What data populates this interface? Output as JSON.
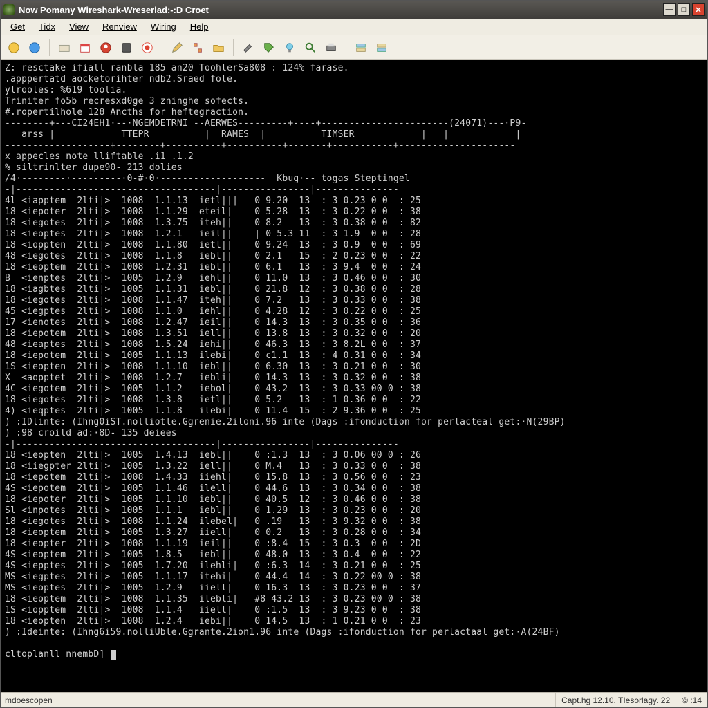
{
  "window": {
    "title": "Now Pomany Wireshark-Wreserlad:-:D Croet"
  },
  "menu": [
    "Get",
    "Tidx",
    "View",
    "Renview",
    "Wiring",
    "Help"
  ],
  "toolbar_icons": [
    "world-yellow-icon",
    "world-blue-icon",
    "folder-open-icon",
    "calendar-icon",
    "user-red-icon",
    "disk-icon",
    "circle-red-icon",
    "pencil-icon",
    "struct-icon",
    "folder-icon",
    "hammer-icon",
    "tag-icon",
    "bulb-icon",
    "magnifier-icon",
    "printer-icon",
    "layers-icon",
    "layers-alt-icon"
  ],
  "header_lines": [
    "Z: resctake ifiall ranbla 185 an20 ToohlerSa808 : 124% farase.",
    ".apppertatd aocketorihter ndb2.Sraed fole.",
    "ylrooles: %619 toolia.",
    "Triniter fo5b recresxd0ge 3 zninghe sofects.",
    "#.ropertilhole 128 Ancths for heftegraction."
  ],
  "box_rule": "--------+---CI24EH1·--·NGEMDETRNI --AERWES---------+----+-----------------------(24071)---·P9-",
  "box_cols": "   arss |            TTEPR          |  RAMES  |          TIMSER            |   |            |",
  "box_close": "-------------------+--------+----------+----------+-------+-----------+---------------------",
  "note1": "x appecles note lliftable .i1 .1.2",
  "note2": "% siltrinlter dupe90- 213 dolies",
  "sub_header": "/4·--------·---------·0-#·0·-------------------  Kbug·-- togas Steptingel",
  "rule_thin": "-|------------------------------------|----------------|---------------",
  "rows1": [
    [
      "4l",
      "<iapptem",
      "2lti|>",
      "1008",
      "1.1.13",
      "ietl|||",
      "0 9.20",
      "13",
      ":",
      "3 0.23",
      "0 0",
      ":",
      "25"
    ],
    [
      "18",
      "<iepoter",
      "2lti|>",
      "1008",
      "1.1.29",
      "eteil|",
      "0 5.28",
      "13",
      ":",
      "3 0.22",
      "0 0",
      ":",
      "38"
    ],
    [
      "18",
      "<iegotes",
      "2lti|>",
      "1008",
      "1.3.75",
      "iteh||",
      "0 8.2 ",
      "13",
      ":",
      "3 0.38",
      "0 0",
      ":",
      "82"
    ],
    [
      "18",
      "<ieoptes",
      "2lti|>",
      "1008",
      "1.2.1 ",
      "ieil||",
      "| 0 5.3",
      "11",
      ":",
      "3 1.9 ",
      "0 0",
      ":",
      "28"
    ],
    [
      "18",
      "<ioppten",
      "2lti|>",
      "1008",
      "1.1.80",
      "ietl||",
      "0 9.24",
      "13",
      ":",
      "3 0.9 ",
      "0 0",
      ":",
      "69"
    ],
    [
      "48",
      "<iegotes",
      "2lti|>",
      "1008",
      "1.1.8 ",
      "iebl||",
      "0 2.1 ",
      "15",
      ":",
      "2 0.23",
      "0 0",
      ":",
      "22"
    ],
    [
      "18",
      "<ieoptem",
      "2lti|>",
      "1008",
      "1.2.31",
      "iebl||",
      "0 6.1 ",
      "13",
      ":",
      "3 9.4 ",
      "0 0",
      ":",
      "24"
    ],
    [
      "B ",
      "<ienptes",
      "2lti|>",
      "1005",
      "1.2.9 ",
      "iehl||",
      "0 11.0",
      "13",
      ":",
      "3 0.46",
      "0 0",
      ":",
      "30"
    ],
    [
      "18",
      "<iagbtes",
      "2lti|>",
      "1005",
      "1.1.31",
      "iebl||",
      "0 21.8",
      "12",
      ":",
      "3 0.38",
      "0 0",
      ":",
      "28"
    ],
    [
      "18",
      "<iegotes",
      "2lti|>",
      "1008",
      "1.1.47",
      "iteh||",
      "0 7.2 ",
      "13",
      ":",
      "3 0.33",
      "0 0",
      ":",
      "38"
    ],
    [
      "45",
      "<iegptes",
      "2lti|>",
      "1008",
      "1.1.0 ",
      "iehl||",
      "0 4.28",
      "12",
      ":",
      "3 0.22",
      "0 0",
      ":",
      "25"
    ],
    [
      "17",
      "<ienotes",
      "2lti|>",
      "1008",
      "1.2.47",
      "ieil||",
      "0 14.3",
      "13",
      ":",
      "3 0.35",
      "0 0",
      ":",
      "36"
    ],
    [
      "18",
      "<iepotem",
      "2lti|>",
      "1008",
      "1.3.51",
      "iell||",
      "0 13.8",
      "13",
      ":",
      "3 0.32",
      "0 0",
      ":",
      "20"
    ],
    [
      "48",
      "<ieaptes",
      "2lti|>",
      "1008",
      "1.5.24",
      "iehi||",
      "0 46.3",
      "13",
      ":",
      "3 8.2L",
      "0 0",
      ":",
      "37"
    ],
    [
      "18",
      "<iepotem",
      "2lti|>",
      "1005",
      "1.1.13",
      "ilebi|",
      "0 c1.1",
      "13",
      ":",
      "4 0.31",
      "0 0",
      ":",
      "34"
    ],
    [
      "1S",
      "<ieopten",
      "2lti|>",
      "1008",
      "1.1.10",
      "iebl||",
      "0 6.30",
      "13",
      ":",
      "3 0.21",
      "0 0",
      ":",
      "30"
    ],
    [
      "X ",
      "<aopptet",
      "2lti|>",
      "1008",
      "1.2.7 ",
      "iebli|",
      "0 14.3",
      "13",
      ":",
      "3 0.32",
      "0 0",
      ":",
      "38"
    ],
    [
      "4C",
      "<iegotem",
      "2lti|>",
      "1005",
      "1.1.2 ",
      "iebol|",
      "0 43.2",
      "13",
      ":",
      "3 0.33",
      "00 0",
      ":",
      "38"
    ],
    [
      "18",
      "<iegotes",
      "2lti|>",
      "1008",
      "1.3.8 ",
      "ietl||",
      "0 5.2 ",
      "13",
      ":",
      "1 0.36",
      "0 0",
      ":",
      "22"
    ],
    [
      "4)",
      "<ieqptes",
      "2lti|>",
      "1005",
      "1.1.8 ",
      "ilebi|",
      "0 11.4",
      "15",
      ":",
      "2 9.36",
      "0 0",
      ":",
      "25"
    ]
  ],
  "mid1": ") :IDlinte: (Ihng0iST.nolliotle.Ggrenie.2iloni.96 inte (Dags :ifonduction for perlacteal get:·N(29BP)",
  "mid2": ") :98 croild ad:·8D- 135 deiees",
  "rows2": [
    [
      "18",
      "<ieopten",
      "2lti|>",
      "1005",
      "1.4.13",
      "iebl||",
      "0 :1.3",
      "13",
      ":",
      "3 0.06",
      "00 0",
      ":",
      "26"
    ],
    [
      "18",
      "<iiegpter",
      "2lti|>",
      "1005",
      "1.3.22",
      "iell||",
      "0 M.4",
      "13",
      ":",
      "3 0.33",
      "0 0",
      ":",
      "38"
    ],
    [
      "18",
      "<iepotem",
      "2lti|>",
      "1008",
      "1.4.33",
      "iiehl|",
      "0 15.8",
      "13",
      ":",
      "3 0.56",
      "0 0",
      ":",
      "23"
    ],
    [
      "4S",
      "<iepotem",
      "2lti|>",
      "1005",
      "1.1.46",
      "ilell|",
      "0 44.6",
      "13",
      ":",
      "3 0.34",
      "0 0",
      ":",
      "38"
    ],
    [
      "18",
      "<iepoter",
      "2lti|>",
      "1005",
      "1.1.10",
      "iebl||",
      "0 40.5",
      "12",
      ":",
      "3 0.46",
      "0 0",
      ":",
      "38"
    ],
    [
      "Sl",
      "<inpotes",
      "2lti|>",
      "1005",
      "1.1.1 ",
      "iebl||",
      "0 1.29",
      "13",
      ":",
      "3 0.23",
      "0 0",
      ":",
      "20"
    ],
    [
      "18",
      "<iegotes",
      "2lti|>",
      "1008",
      "1.1.24",
      "ilebel|",
      "0 .19",
      "13",
      ":",
      "3 9.32",
      "0 0",
      ":",
      "38"
    ],
    [
      "18",
      "<ieoptem",
      "2lti|>",
      "1005",
      "1.3.27",
      "iiell|",
      "0 0.2 ",
      "13",
      ":",
      "3 0.28",
      "0 0",
      ":",
      "34"
    ],
    [
      "18",
      "<ieopter",
      "2lti|>",
      "1008",
      "1.1.19",
      "ieil||",
      "0 :8.4",
      "15",
      ":",
      "3 0.3 ",
      "0 0",
      ":",
      "2D"
    ],
    [
      "4S",
      "<ieoptem",
      "2lti|>",
      "1005",
      "1.8.5 ",
      "iebl||",
      "0 48.0",
      "13",
      ":",
      "3 0.4 ",
      "0 0",
      ":",
      "22"
    ],
    [
      "4S",
      "<iepptes",
      "2lti|>",
      "1005",
      "1.7.20",
      "ilehli|",
      "0 :6.3",
      "14",
      ":",
      "3 0.21",
      "0 0",
      ":",
      "25"
    ],
    [
      "MS",
      "<iegptes",
      "2lti|>",
      "1005",
      "1.1.17",
      "itehi|",
      "0 44.4",
      "14",
      ":",
      "3 0.22",
      "00 0",
      ":",
      "38"
    ],
    [
      "MS",
      "<ieoptes",
      "2lti|>",
      "1005",
      "1.2.9 ",
      "iiell|",
      "0 16.3",
      "13",
      ":",
      "3 0.23",
      "0 0",
      ":",
      "37"
    ],
    [
      "18",
      "<ieoptem",
      "2lti|>",
      "1008",
      "1.1.35",
      "ilebli|",
      "#8 43.2",
      "13",
      ":",
      "3 0.23",
      "00 0",
      ":",
      "38"
    ],
    [
      "1S",
      "<iopptem",
      "2lti|>",
      "1008",
      "1.1.4 ",
      "iiell|",
      "0 :1.5",
      "13",
      ":",
      "3 9.23",
      "0 0",
      ":",
      "38"
    ],
    [
      "18",
      "<ieopten",
      "2lti|>",
      "1008",
      "1.2.4 ",
      "iebi||",
      "0 14.5",
      "13",
      ":",
      "1 0.21",
      "0 0",
      ":",
      "23"
    ]
  ],
  "mid3": ") :Ideinte: (Ihng6i59.nolliUble.Ggrante.2ion1.96 inte (Dags :ifonduction for perlactaal get:·A(24BF)",
  "prompt": "cltoplanll nnembD]",
  "status": {
    "left": "mdoescopen",
    "right1": "Capt.hg 12.10.  TIesorlagy. 22",
    "right2": "© :14"
  }
}
